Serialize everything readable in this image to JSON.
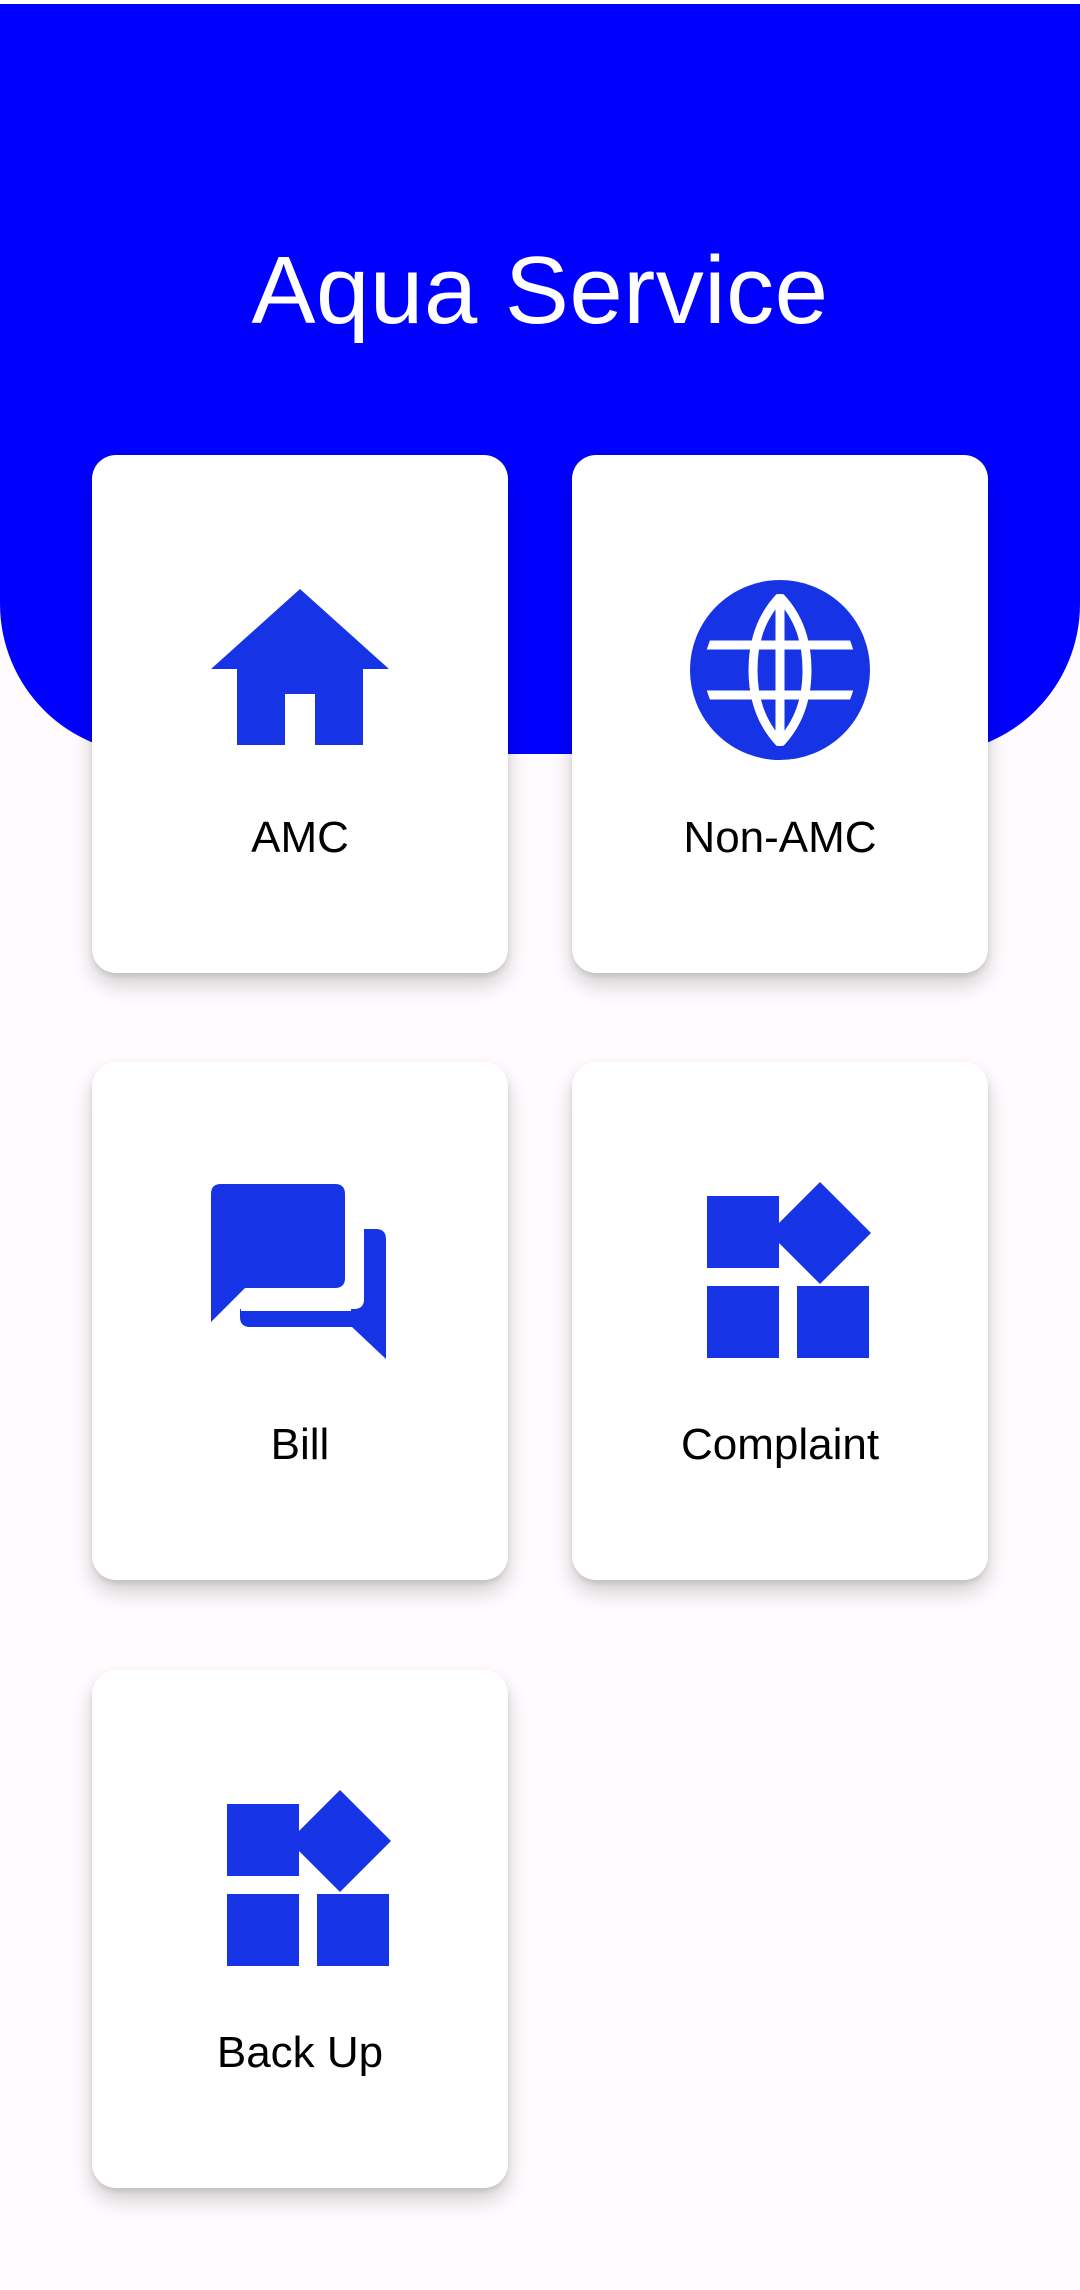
{
  "app": {
    "title": "Aqua Service"
  },
  "colors": {
    "header_background": "#0000FF",
    "icon": "#1733E6",
    "card_background": "#FFFFFF",
    "page_background": "#FFFBFE",
    "label_text": "#000000"
  },
  "menu": {
    "items": [
      {
        "label": "AMC",
        "icon": "home-icon"
      },
      {
        "label": "Non-AMC",
        "icon": "globe-icon"
      },
      {
        "label": "Bill",
        "icon": "chat-bubbles-icon"
      },
      {
        "label": "Complaint",
        "icon": "widgets-icon"
      },
      {
        "label": "Back Up",
        "icon": "widgets-icon"
      }
    ]
  }
}
